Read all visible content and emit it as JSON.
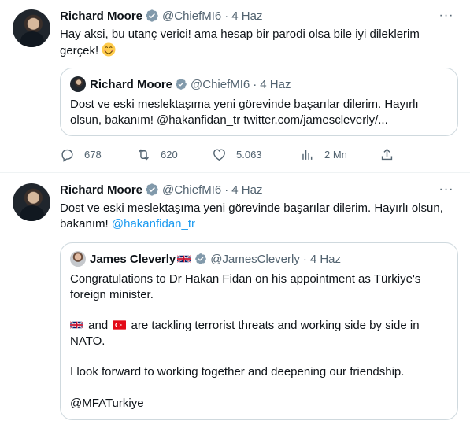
{
  "tweets": [
    {
      "author": {
        "name": "Richard Moore",
        "handle": "@ChiefMI6"
      },
      "separator": "·",
      "time": "4 Haz",
      "more_label": "···",
      "text": "Hay aksi, bu utanç verici! ama hesap bir parodi olsa bile iyi dileklerim\ngerçek!",
      "emoji": "smiling-face-icon",
      "quote": {
        "author": {
          "name": "Richard Moore",
          "handle": "@ChiefMI6"
        },
        "time": "4 Haz",
        "text": "Dost ve eski meslektaşıma yeni görevinde başarılar dilerim.  Hayırlı\nolsun, bakanım! @hakanfidan_tr twitter.com/jamescleverly/..."
      },
      "actions": {
        "replies": "678",
        "retweets": "620",
        "likes": "5.063",
        "views": "2 Mn"
      }
    },
    {
      "author": {
        "name": "Richard Moore",
        "handle": "@ChiefMI6"
      },
      "separator": "·",
      "time": "4 Haz",
      "more_label": "···",
      "text_main": "Dost ve eski meslektaşıma yeni görevinde başarılar dilerim.  Hayırlı olsun,\nbakanım! ",
      "mention": "@hakanfidan_tr",
      "quote": {
        "author": {
          "name": "James Cleverly",
          "handle": "@JamesCleverly"
        },
        "time": "4 Haz",
        "line1": "Congratulations to Dr Hakan Fidan on his appointment as Türkiye's\nforeign minister.",
        "line2_and": " and ",
        "line2_rest": " are tackling terrorist threats and working side by side in\nNATO.",
        "line3": "I look forward to working together and deepening our friendship.",
        "line4": "@MFATurkiye"
      }
    }
  ],
  "colors": {
    "accent": "#1d9bf0",
    "text": "#0f1419",
    "muted": "#536471",
    "border": "#cfd9de"
  }
}
